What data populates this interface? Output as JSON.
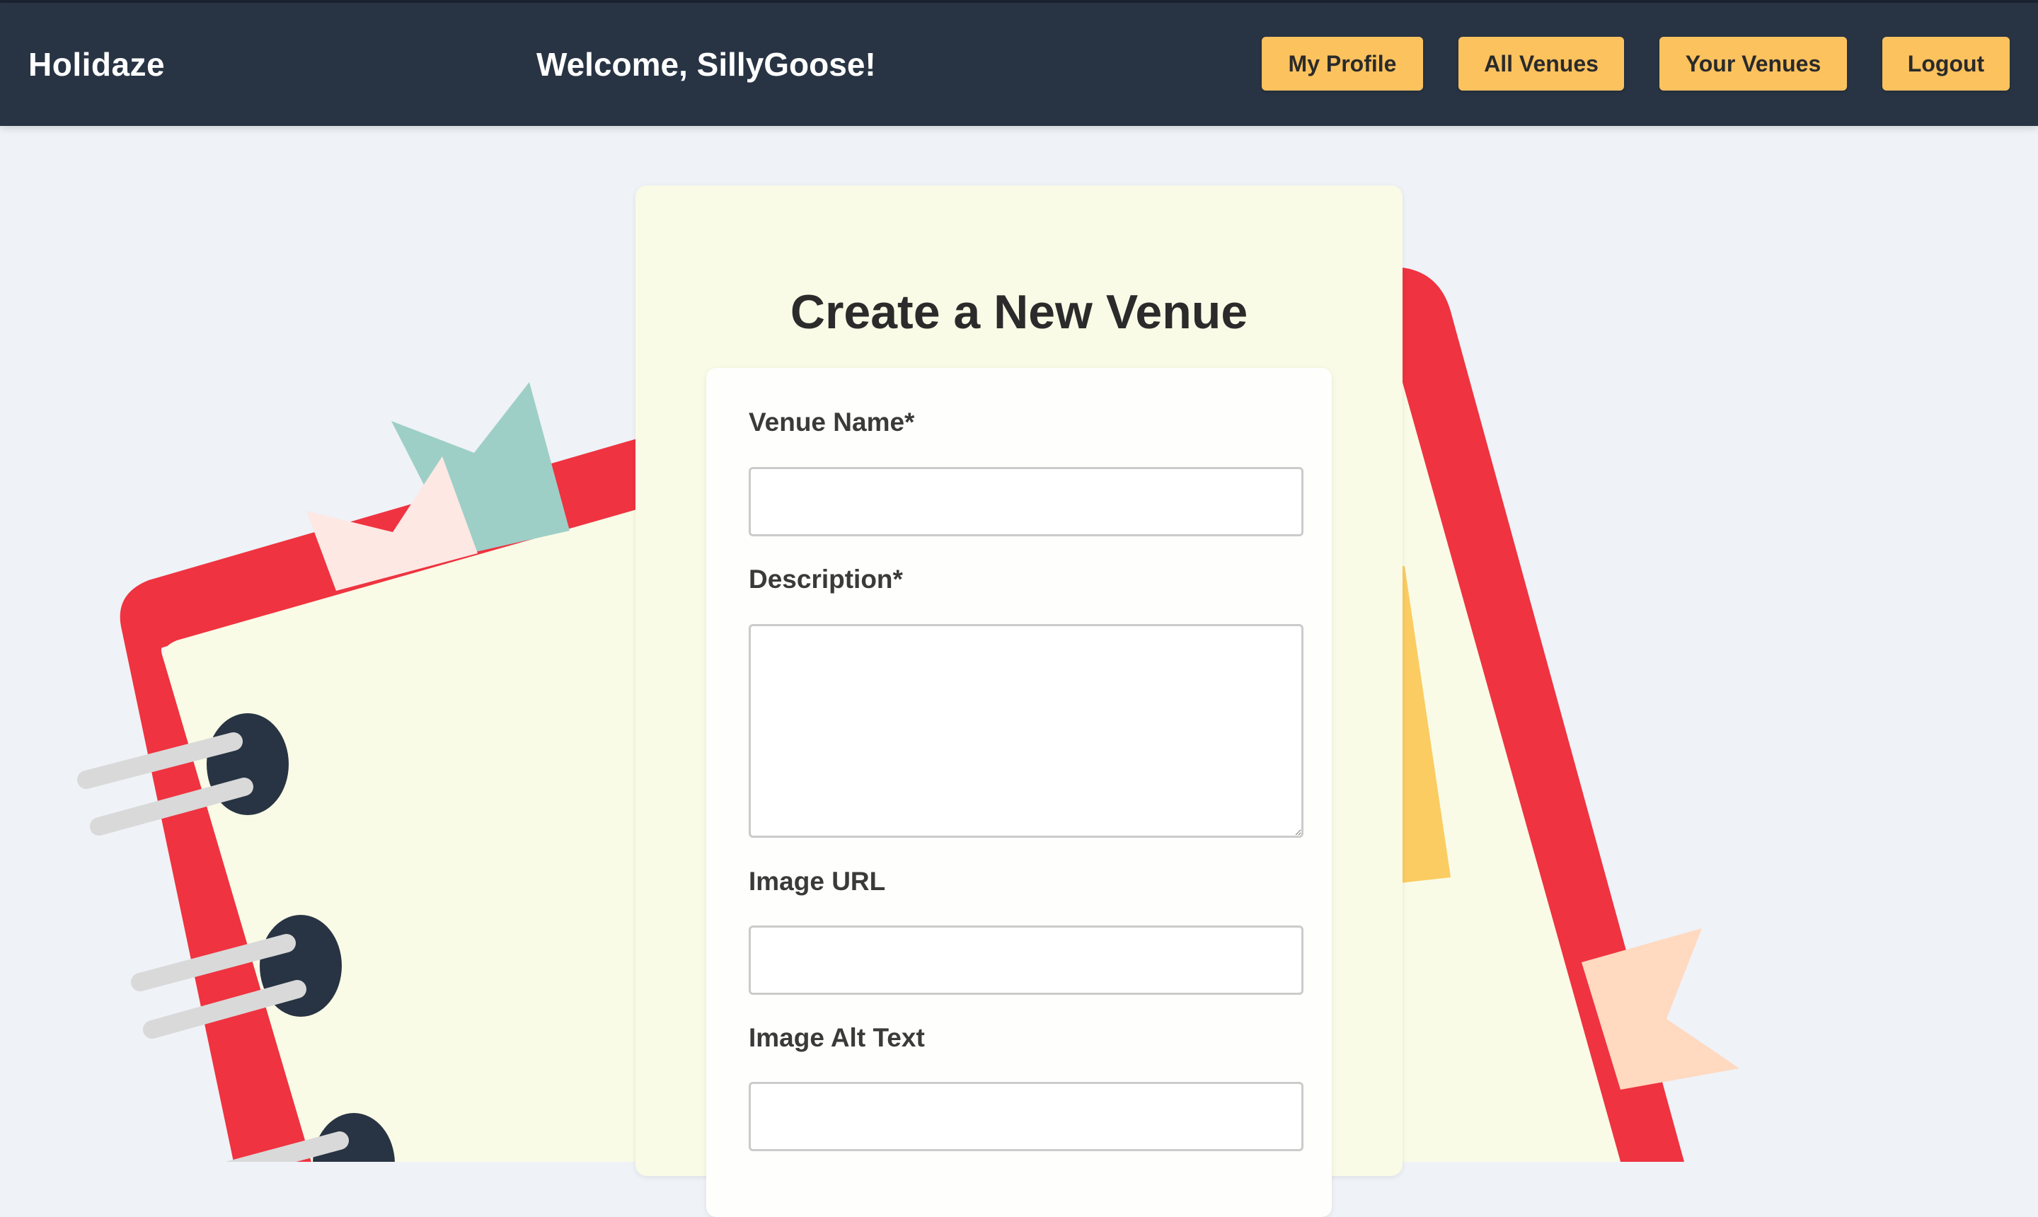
{
  "header": {
    "brand": "Holidaze",
    "welcome": "Welcome, SillyGoose!",
    "nav": {
      "my_profile": "My Profile",
      "all_venues": "All Venues",
      "your_venues": "Your Venues",
      "logout": "Logout"
    }
  },
  "form": {
    "title": "Create a New Venue",
    "fields": [
      {
        "label": "Venue Name*",
        "value": "",
        "placeholder": ""
      },
      {
        "label": "Description*",
        "value": "",
        "placeholder": ""
      },
      {
        "label": "Image URL",
        "value": "",
        "placeholder": ""
      },
      {
        "label": "Image Alt Text",
        "value": "",
        "placeholder": ""
      }
    ]
  },
  "colors": {
    "header_bg": "#283443",
    "button_bg": "#fcc25e",
    "page_bg": "#eff2f7",
    "card_bg": "#f9fbe6",
    "notebook_red": "#ef3340",
    "notebook_paper": "#f9fbe6"
  },
  "icons": [
    "notebook-illustration",
    "bookmark-ribbon-icon"
  ]
}
